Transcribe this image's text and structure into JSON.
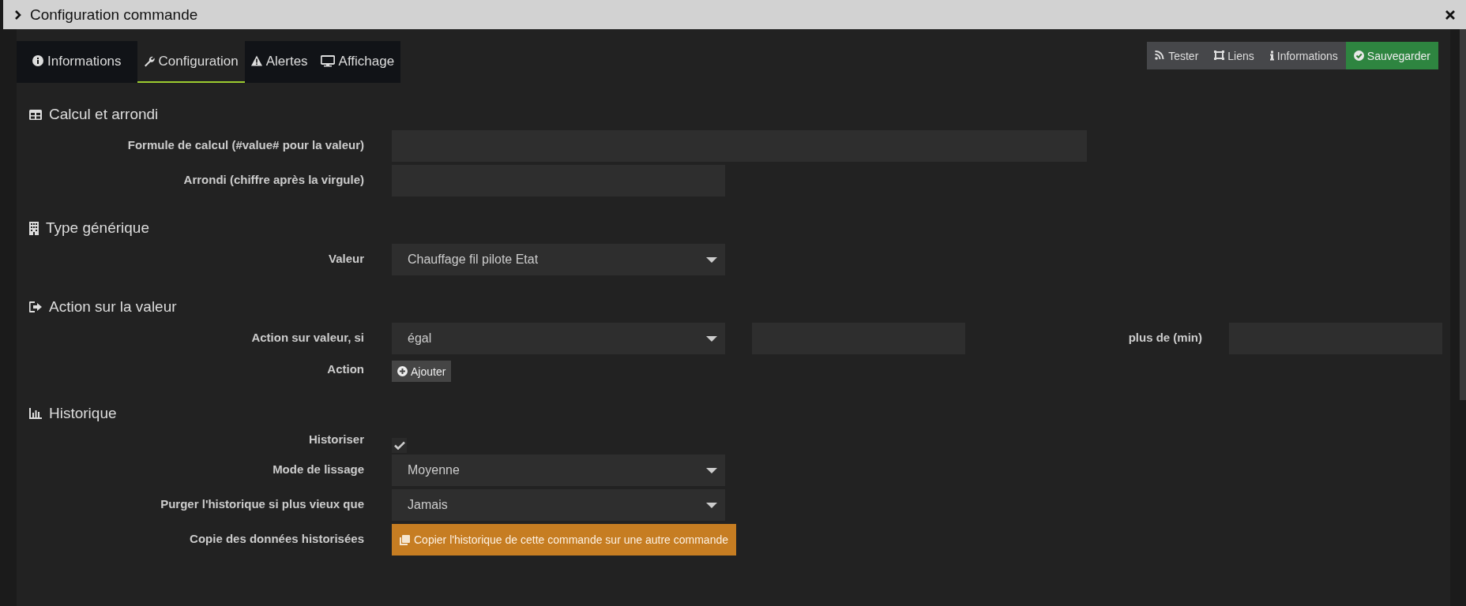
{
  "window": {
    "title": "Configuration commande"
  },
  "tabs": [
    {
      "label": "Informations",
      "selected": false
    },
    {
      "label": "Configuration",
      "selected": true
    },
    {
      "label": "Alertes",
      "selected": false
    },
    {
      "label": "Affichage",
      "selected": false
    }
  ],
  "toolbar": [
    {
      "label": "Tester",
      "kind": "default"
    },
    {
      "label": "Liens",
      "kind": "default"
    },
    {
      "label": "Informations",
      "kind": "default"
    },
    {
      "label": "Sauvegarder",
      "kind": "success"
    }
  ],
  "sections": [
    {
      "title": "Calcul et arrondi",
      "rows": [
        {
          "label": "Formule de calcul (#value# pour la valeur)",
          "kind": "text_wide"
        },
        {
          "label": "Arrondi (chiffre après la virgule)",
          "kind": "text"
        }
      ]
    },
    {
      "title": "Type générique",
      "rows": [
        {
          "label": "Valeur",
          "kind": "select",
          "value": "Chauffage fil pilote Etat"
        }
      ]
    },
    {
      "title": "Action sur la valeur",
      "rows": [
        {
          "label": "Action sur valeur, si",
          "kind": "condition",
          "value": "égal",
          "extra_label": "plus de (min)"
        },
        {
          "label": "Action",
          "kind": "button",
          "button": "Ajouter"
        }
      ]
    },
    {
      "title": "Historique",
      "rows": [
        {
          "label": "Historiser",
          "kind": "checkbox",
          "checked": true
        },
        {
          "label": "Mode de lissage",
          "kind": "select",
          "value": "Moyenne"
        },
        {
          "label": "Purger l'historique si plus vieux que",
          "kind": "select",
          "value": "Jamais"
        },
        {
          "label": "Copie des données historisées",
          "kind": "warning_button",
          "button": "Copier l'historique de cette commande sur une autre commande"
        }
      ]
    }
  ]
}
